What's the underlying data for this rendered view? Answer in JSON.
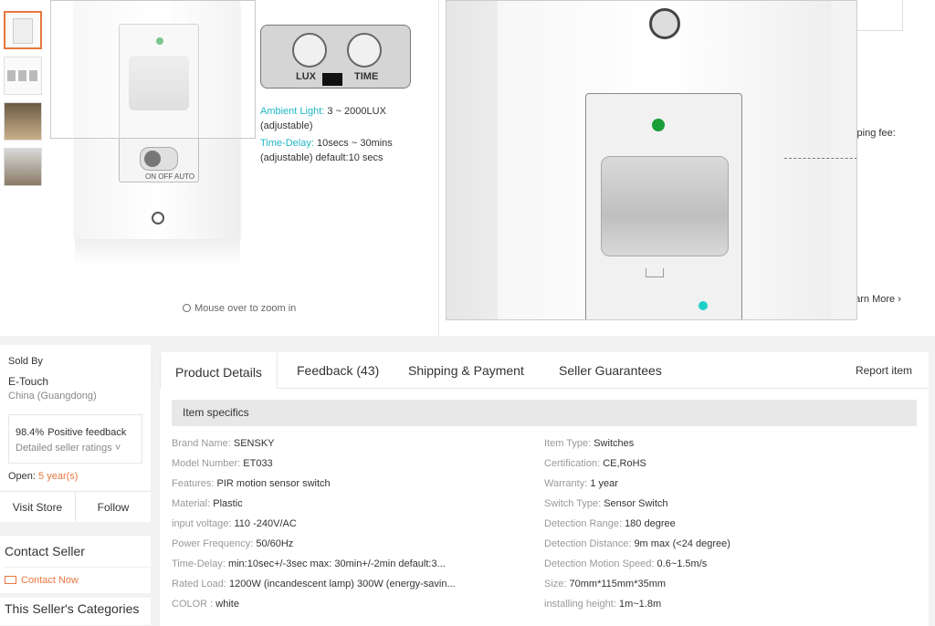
{
  "gallery": {
    "overlay": {
      "ambient_label": "Ambient Light:",
      "ambient_value": "3 ~ 2000LUX",
      "ambient_adj": "(adjustable)",
      "delay_label": "Time-Delay:",
      "delay_value": "10secs ~ 30mins",
      "delay_adj": "(adjustable) default:10 secs",
      "dial_lux": "LUX",
      "dial_time": "TIME"
    },
    "switch_text": "ON OFF AUTO",
    "zoom_hint": "Mouse over to zoom in"
  },
  "right_info": {
    "shipping_fee": "ipping fee:",
    "learn_more": "earn More ›"
  },
  "seller": {
    "sold_by": "Sold By",
    "name": "E-Touch",
    "location": "China (Guangdong)",
    "feedback_pct": "98.4%",
    "feedback_label": "Positive feedback",
    "detailed": "Detailed seller ratings ˅",
    "open_label": "Open:",
    "open_years": "5 year(s)",
    "visit": "Visit Store",
    "follow": "Follow"
  },
  "contact": {
    "title": "Contact Seller",
    "link": "Contact Now"
  },
  "categories": {
    "title": "This Seller's Categories"
  },
  "tabs": [
    "Product Details",
    "Feedback (43)",
    "Shipping & Payment",
    "Seller Guarantees"
  ],
  "report": "Report item",
  "item_specifics": {
    "title": "Item specifics",
    "left": [
      {
        "k": "Brand Name: ",
        "v": "SENSKY"
      },
      {
        "k": "Model Number: ",
        "v": "ET033"
      },
      {
        "k": "Features: ",
        "v": "PIR motion sensor switch"
      },
      {
        "k": "Material: ",
        "v": "Plastic"
      },
      {
        "k": "input voltage: ",
        "v": "110 -240V/AC"
      },
      {
        "k": "Power Frequency: ",
        "v": "50/60Hz"
      },
      {
        "k": "Time-Delay: ",
        "v": "min:10sec+/-3sec max: 30min+/-2min default:3..."
      },
      {
        "k": "Rated Load: ",
        "v": "1200W (incandescent lamp) 300W (energy-savin..."
      },
      {
        "k": "COLOR : ",
        "v": "white"
      }
    ],
    "right": [
      {
        "k": "Item Type: ",
        "v": "Switches"
      },
      {
        "k": "Certification: ",
        "v": "CE,RoHS"
      },
      {
        "k": "Warranty: ",
        "v": "1 year"
      },
      {
        "k": "Switch Type: ",
        "v": "Sensor Switch"
      },
      {
        "k": "Detection Range: ",
        "v": "180 degree"
      },
      {
        "k": "Detection Distance: ",
        "v": "9m max (<24 degree)"
      },
      {
        "k": "Detection Motion Speed: ",
        "v": "0.6~1.5m/s"
      },
      {
        "k": "Size: ",
        "v": "70mm*115mm*35mm"
      },
      {
        "k": "installing height: ",
        "v": "1m~1.8m"
      }
    ]
  },
  "colors": {
    "accent": "#e8773f",
    "highlight": "#1fb6c4"
  }
}
